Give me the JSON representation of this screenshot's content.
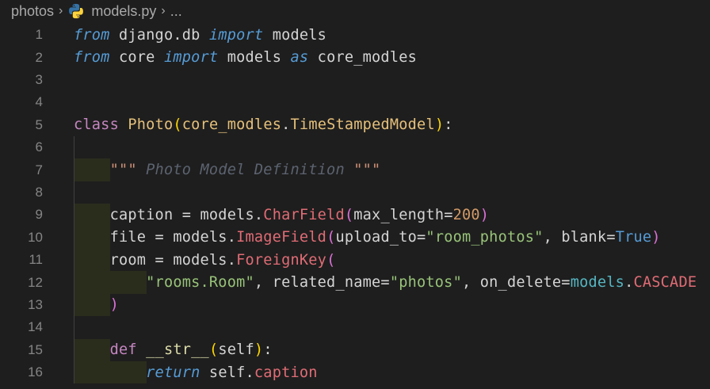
{
  "breadcrumb": {
    "folder": "photos",
    "file": "models.py",
    "more": "...",
    "separator": "›"
  },
  "icons": {
    "python_file": "python-icon"
  },
  "code_lines": [
    {
      "n": "1",
      "tokens": [
        [
          "kw-i",
          "from"
        ],
        [
          "plain",
          " django.db "
        ],
        [
          "kw-i",
          "import"
        ],
        [
          "plain",
          " models"
        ]
      ]
    },
    {
      "n": "2",
      "tokens": [
        [
          "kw-i",
          "from"
        ],
        [
          "plain",
          " core "
        ],
        [
          "kw-i",
          "import"
        ],
        [
          "plain",
          " models "
        ],
        [
          "kw-i",
          "as"
        ],
        [
          "plain",
          " core_modles"
        ]
      ]
    },
    {
      "n": "3",
      "tokens": []
    },
    {
      "n": "4",
      "tokens": []
    },
    {
      "n": "5",
      "tokens": [
        [
          "kw",
          "class"
        ],
        [
          "plain",
          " "
        ],
        [
          "cls",
          "Photo"
        ],
        [
          "paren2",
          "("
        ],
        [
          "cls",
          "core_modles"
        ],
        [
          "plain",
          "."
        ],
        [
          "cls",
          "TimeStampedModel"
        ],
        [
          "paren2",
          ")"
        ],
        [
          "plain",
          ":"
        ]
      ]
    },
    {
      "n": "6",
      "tokens": []
    },
    {
      "n": "7",
      "guides": 1,
      "tokens": [
        [
          "plain",
          "    "
        ],
        [
          "str",
          "\"\"\""
        ],
        [
          "cmt",
          " Photo Model Definition "
        ],
        [
          "str",
          "\"\"\""
        ]
      ]
    },
    {
      "n": "8",
      "tokens": []
    },
    {
      "n": "9",
      "guides": 1,
      "tokens": [
        [
          "plain",
          "    caption = models."
        ],
        [
          "field",
          "CharField"
        ],
        [
          "paren",
          "("
        ],
        [
          "plain",
          "max_length="
        ],
        [
          "num",
          "200"
        ],
        [
          "paren",
          ")"
        ]
      ]
    },
    {
      "n": "10",
      "guides": 1,
      "tokens": [
        [
          "plain",
          "    file = models."
        ],
        [
          "field",
          "ImageField"
        ],
        [
          "paren",
          "("
        ],
        [
          "plain",
          "upload_to="
        ],
        [
          "strg",
          "\"room_photos\""
        ],
        [
          "plain",
          ", blank="
        ],
        [
          "kw-b",
          "True"
        ],
        [
          "paren",
          ")"
        ]
      ]
    },
    {
      "n": "11",
      "guides": 1,
      "tokens": [
        [
          "plain",
          "    room = models."
        ],
        [
          "field",
          "ForeignKey"
        ],
        [
          "paren",
          "("
        ]
      ]
    },
    {
      "n": "12",
      "guides": 2,
      "tokens": [
        [
          "plain",
          "        "
        ],
        [
          "strg",
          "\"rooms.Room\""
        ],
        [
          "plain",
          ", related_name="
        ],
        [
          "strg",
          "\"photos\""
        ],
        [
          "plain",
          ", on_delete="
        ],
        [
          "const",
          "models"
        ],
        [
          "plain",
          "."
        ],
        [
          "field",
          "CASCADE"
        ]
      ]
    },
    {
      "n": "13",
      "guides": 1,
      "tokens": [
        [
          "plain",
          "    "
        ],
        [
          "paren",
          ")"
        ]
      ]
    },
    {
      "n": "14",
      "tokens": []
    },
    {
      "n": "15",
      "guides": 1,
      "tokens": [
        [
          "plain",
          "    "
        ],
        [
          "kw",
          "def"
        ],
        [
          "plain",
          " "
        ],
        [
          "fn",
          "__str__"
        ],
        [
          "paren2",
          "("
        ],
        [
          "plain",
          "self"
        ],
        [
          "paren2",
          ")"
        ],
        [
          "plain",
          ":"
        ]
      ]
    },
    {
      "n": "16",
      "guides": 2,
      "tokens": [
        [
          "plain",
          "        "
        ],
        [
          "kw-i",
          "return"
        ],
        [
          "plain",
          " self."
        ],
        [
          "field",
          "caption"
        ]
      ]
    }
  ]
}
